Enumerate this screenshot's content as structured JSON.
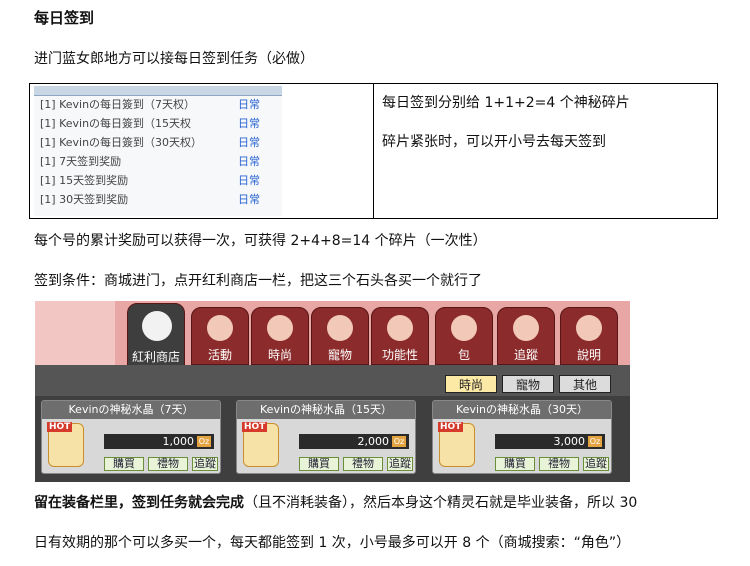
{
  "heading": "每日签到",
  "intro": "进门蓝女郎地方可以接每日签到任务（必做）",
  "quest_list": [
    {
      "text": "[1] Kevinの每日簽到（7天权）",
      "type": "日常"
    },
    {
      "text": "[1] Kevinの每日簽到（15天权",
      "type": "日常"
    },
    {
      "text": "[1] Kevinの每日簽到（30天权）",
      "type": "日常"
    },
    {
      "text": "[1] 7天签到奖励",
      "type": "日常"
    },
    {
      "text": "[1] 15天签到奖励",
      "type": "日常"
    },
    {
      "text": "[1] 30天签到奖励",
      "type": "日常"
    }
  ],
  "right_notes": [
    "每日签到分别给 1+1+2=4 个神秘碎片",
    "碎片紧张时，可以开小号去每天签到"
  ],
  "cumulative": "每个号的累计奖励可以获得一次，可获得 2+4+8=14 个碎片（一次性）",
  "condition": "签到条件：商城进门，点开红利商店一栏，把这三个石头各买一个就行了",
  "shop": {
    "tabs": [
      "紅利商店",
      "活動",
      "時尚",
      "寵物",
      "功能性",
      "包",
      "追蹤",
      "說明"
    ],
    "subtabs": [
      "時尚",
      "寵物",
      "其他"
    ],
    "hot_label": "HOT",
    "currency": "Oz",
    "buttons": [
      "購買",
      "禮物",
      "追蹤"
    ],
    "items": [
      {
        "name": "Kevinの神秘水晶（7天）",
        "price": "1,000"
      },
      {
        "name": "Kevinの神秘水晶（15天）",
        "price": "2,000"
      },
      {
        "name": "Kevinの神秘水晶（30天）",
        "price": "3,000"
      }
    ]
  },
  "footer": {
    "bold": "留在装备栏里，签到任务就会完成",
    "paren": "（且不消耗装备）",
    "rest1": "，然后本身这个精灵石就是毕业装备，所以 30",
    "line2": "日有效期的那个可以多买一个，每天都能签到 1 次，小号最多可以开 8 个（商城搜索：“角色”）"
  }
}
